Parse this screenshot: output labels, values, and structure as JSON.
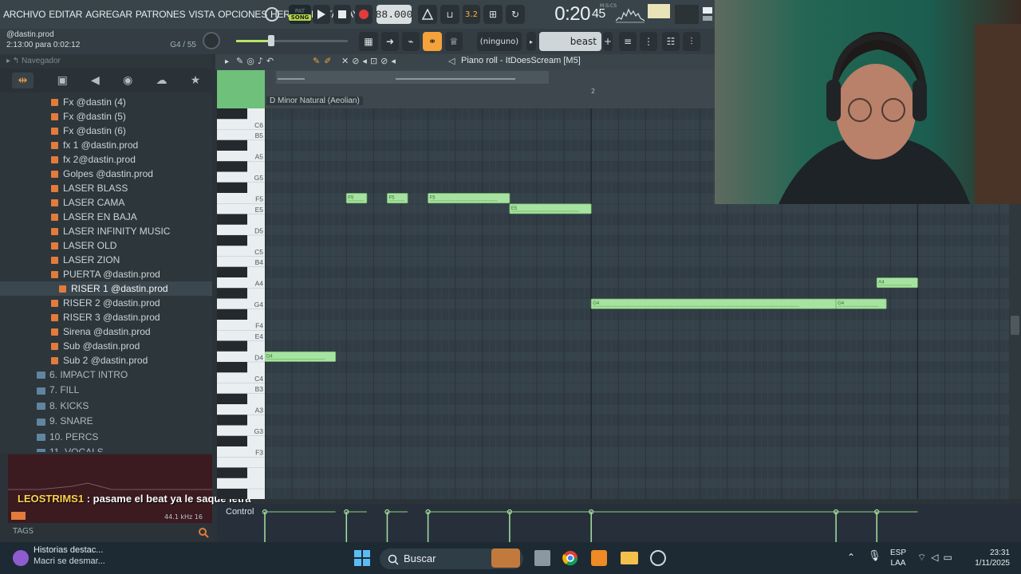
{
  "menu": [
    "ARCHIVO",
    "EDITAR",
    "AGREGAR",
    "PATRONES",
    "VISTA",
    "OPCIONES",
    "HERRAMIENTAS",
    "AYU"
  ],
  "transport": {
    "pat_label": "PAT",
    "song_label": "SONG",
    "tempo": "88.000",
    "time_main": "0:20",
    "time_sub": "45",
    "time_unit": "M:S:CS",
    "step": "3.2"
  },
  "hint": {
    "line1": "@dastin.prod",
    "line2": "2:13:00 para 0:02:12",
    "note_info": "G4 / 55"
  },
  "toolbar2": {
    "ninguno": "(ninguno)",
    "preset": "beast",
    "add": "+"
  },
  "browser": {
    "header": "Navegador",
    "items": [
      "Fx @dastin (4)",
      "Fx @dastin (5)",
      "Fx @dastin (6)",
      "fx 1 @dastin.prod",
      "fx 2@dastin.prod",
      "Golpes @dastin.prod",
      "LASER BLASS",
      "LASER CAMA",
      "LASER EN BAJA",
      "LASER INFINITY MUSIC",
      "LASER OLD",
      "LASER ZION",
      "PUERTA @dastin.prod",
      "RISER 1 @dastin.prod",
      "RISER 2 @dastin.prod",
      "RISER 3 @dastin.prod",
      "Sirena @dastin.prod",
      "Sub @dastin.prod",
      "Sub 2 @dastin.prod"
    ],
    "selected_index": 13,
    "folders": [
      "6. IMPACT INTRO",
      "7. FILL",
      "8. KICKS",
      "9. SNARE",
      "10. PERCS",
      "11. VOCALS"
    ]
  },
  "chat": {
    "user": "LEOSTRIMS1",
    "message": " : pasame el beat ya le saque letra",
    "rate": "44.1 kHz 16"
  },
  "tags_label": "TAGS",
  "piano_roll": {
    "title": "Piano roll - ItDoesScream [M5]",
    "scale": "D Minor Natural (Aeolian)",
    "bar_marker": "2",
    "control_label": "Control",
    "key_labels": [
      "C6",
      "B5",
      "A5",
      "G5",
      "F5",
      "E5",
      "D5",
      "C5",
      "B4",
      "A4",
      "G4",
      "F4",
      "E4",
      "D4",
      "C4",
      "B3",
      "A3",
      "G3",
      "F3"
    ],
    "notes": [
      {
        "pitch": "F5",
        "start": 3.0,
        "len": 0.75
      },
      {
        "pitch": "F5",
        "start": 4.5,
        "len": 0.75
      },
      {
        "pitch": "F5",
        "start": 6.0,
        "len": 3.0
      },
      {
        "pitch": "E5",
        "start": 9.0,
        "len": 3.0
      },
      {
        "pitch": "G4",
        "start": 12.0,
        "len": 9.0
      },
      {
        "pitch": "G4",
        "start": 21.0,
        "len": 1.85
      },
      {
        "pitch": "A4",
        "start": 22.5,
        "len": 1.5
      },
      {
        "pitch": "D4",
        "start": 0.0,
        "len": 2.6
      }
    ]
  },
  "taskbar": {
    "news_title": "Historias destac...",
    "news_sub": "Macri se desmar...",
    "search": "Buscar",
    "lang1": "ESP",
    "lang2": "LAA",
    "time": "23:31",
    "date": "1/11/2025"
  }
}
